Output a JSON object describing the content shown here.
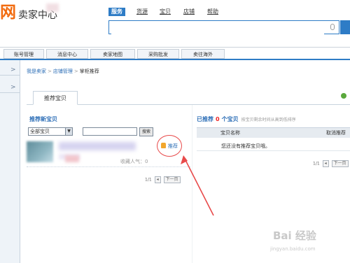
{
  "header": {
    "logo_char": "网",
    "logo_text": "卖家中心",
    "nav": [
      "服务",
      "货源",
      "宝贝",
      "店铺",
      "帮助"
    ],
    "search_placeholder": ""
  },
  "top_tabs": [
    "账号管理",
    "消息中心",
    "卖家地图",
    "采购批发",
    "卖往海外"
  ],
  "sidebar": {
    "arrow": ">"
  },
  "breadcrumb": [
    "我是卖家",
    "店铺管理",
    "掌柜推荐"
  ],
  "panel_tab": "推荐宝贝",
  "left_section": {
    "title": "推荐新宝贝",
    "filter_value": "全部宝贝",
    "keyword": "",
    "search_button": "搜索",
    "item": {
      "popularity_label": "收藏人气：0",
      "recommend_label": "推荐"
    },
    "pager": {
      "page": "1/1",
      "next": "下一页"
    }
  },
  "right_section": {
    "title_prefix": "已推荐",
    "count": "0",
    "title_suffix": "个宝贝",
    "hint": "按宝贝剩余时间从高到低排序",
    "col_name": "宝贝名称",
    "col_action": "取消推荐",
    "empty_text": "您还没有推荐宝贝哦。",
    "pager": {
      "page": "1/1",
      "next": "下一页"
    }
  },
  "watermark": {
    "brand": "Bai 经验",
    "url": "jingyan.baidu.com"
  },
  "colors": {
    "accent": "#2e7cc6",
    "logo": "#f26b0f",
    "annotation": "#e84a4a"
  }
}
